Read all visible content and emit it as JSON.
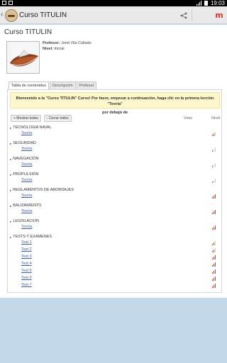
{
  "status_bar": {
    "time": "19:03"
  },
  "action_bar": {
    "title": "Curso TITULIN",
    "back_glyph": "‹"
  },
  "course": {
    "title": "Curso TITULIN",
    "teacher_label": "Profesor:",
    "teacher_value": "Jordi Vila Collado",
    "level_label": "Nivel:",
    "level_value": "Inicial"
  },
  "tabs": [
    {
      "label": "Tabla de contenidos",
      "active": true
    },
    {
      "label": "Descripción",
      "active": false
    },
    {
      "label": "Profesor",
      "active": false
    }
  ],
  "notice": {
    "line1": "Bienvenido a la \"Curso TITULIN\" Curso! Por favor, empezar a continuación, haga clic en la primera lección \"Teoría\"",
    "line2": "por debajo de"
  },
  "buttons": {
    "show_all": "+ Mostrar todos",
    "close_all": "- Cerrar todos"
  },
  "columns": {
    "seen": "Visto",
    "level": "Nivel"
  },
  "sections": [
    {
      "title": "TECNOLOGIA NAVAL",
      "lessons": [
        {
          "label": "Teoría",
          "level": 2
        }
      ]
    },
    {
      "title": "SEGURIDAD",
      "lessons": [
        {
          "label": "Teoría",
          "level": 1
        }
      ]
    },
    {
      "title": "NAVEGACIÓN",
      "lessons": [
        {
          "label": "Teoría",
          "level": 1
        }
      ]
    },
    {
      "title": "PROPULSIÓN",
      "lessons": [
        {
          "label": "Teoría",
          "level": 1
        }
      ]
    },
    {
      "title": "REGLAMENTOS DE ABORDAJES",
      "lessons": [
        {
          "label": "Teoría",
          "level": 3
        }
      ]
    },
    {
      "title": "BALIZAMIENTO",
      "lessons": [
        {
          "label": "Teoría",
          "level": 3
        }
      ]
    },
    {
      "title": "LEGISLACION",
      "lessons": [
        {
          "label": "Teoría",
          "level": 3
        }
      ]
    },
    {
      "title": "TESTS Y EXAMENES",
      "lessons": [
        {
          "label": "Test 1",
          "level": 2
        },
        {
          "label": "Test 2",
          "level": 2
        },
        {
          "label": "Test 3",
          "level": 3
        },
        {
          "label": "Test 4",
          "level": 3
        },
        {
          "label": "Test 5",
          "level": 3
        },
        {
          "label": "Test 6",
          "level": 3
        },
        {
          "label": "Test 7",
          "level": 3
        }
      ]
    }
  ],
  "colors": {
    "level_on": "#e53b2a",
    "level_off": "#cfcfcf",
    "link": "#3a5fb0",
    "notice_bg": "#fff7cc"
  },
  "icons": {
    "share": "share-icon",
    "moodle": "moodle-icon",
    "back": "back-icon"
  }
}
